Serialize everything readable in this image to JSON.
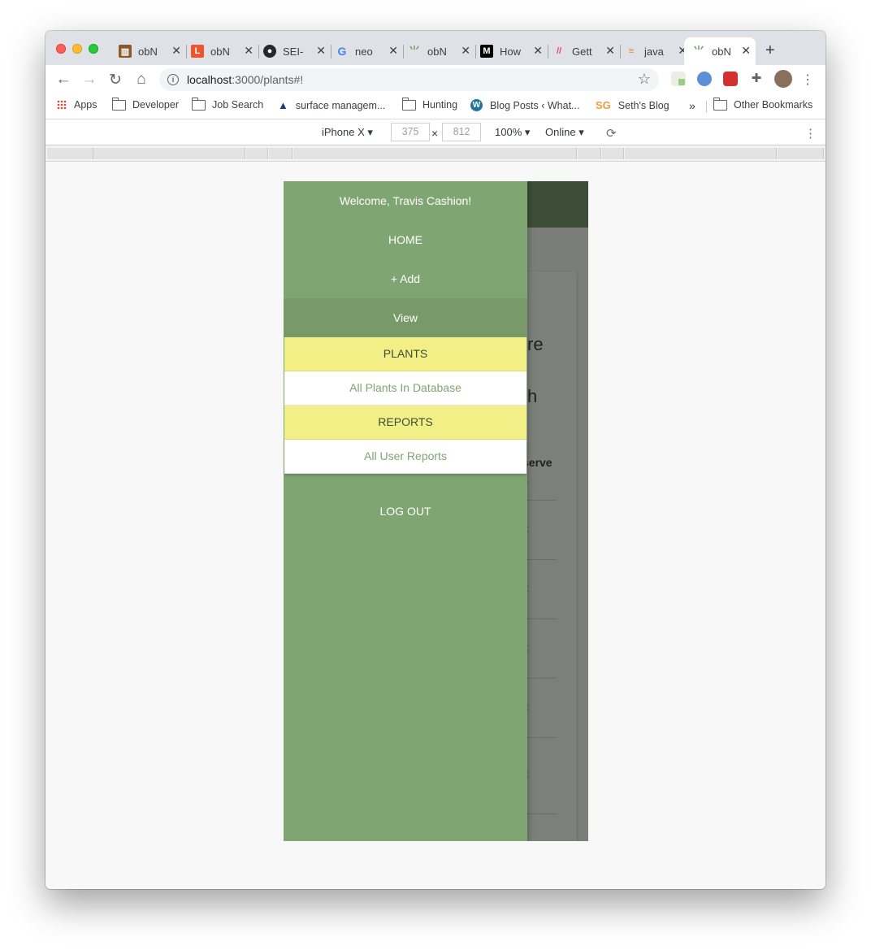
{
  "tabs": [
    {
      "label": "obN",
      "icon": "tab-favicon-icon",
      "color": "#8a5a2b"
    },
    {
      "label": "obN",
      "icon": "tab-favicon-icon",
      "color": "#f0532d"
    },
    {
      "label": "SEI-",
      "icon": "github-icon",
      "color": "#24292e"
    },
    {
      "label": "neo",
      "icon": "google-icon",
      "color": "#4285f4"
    },
    {
      "label": "obN",
      "icon": "sprout-icon",
      "color": "#7fa572"
    },
    {
      "label": "How",
      "icon": "medium-icon",
      "color": "#000000"
    },
    {
      "label": "Gett",
      "icon": "tab-favicon-icon",
      "color": "#ef4a5f"
    },
    {
      "label": "java",
      "icon": "stackoverflow-icon",
      "color": "#f48024"
    },
    {
      "label": "obN",
      "icon": "sprout-icon",
      "color": "#7fa572",
      "active": true
    }
  ],
  "address": {
    "host": "localhost",
    "path": ":3000/plants#!"
  },
  "bookmarks": {
    "apps": "Apps",
    "developer": "Developer",
    "job_search": "Job Search",
    "surface": "surface managem...",
    "hunting": "Hunting",
    "blog_posts": "Blog Posts ‹ What...",
    "seths_blog": "Seth's Blog",
    "seths_blog_icon_text": "SG",
    "more": "»",
    "other": "Other Bookmarks"
  },
  "device": {
    "model": "iPhone X",
    "width": "375",
    "height": "812",
    "zoom": "100%",
    "network": "Online"
  },
  "drawer": {
    "welcome": "Welcome, Travis Cashion!",
    "home": "HOME",
    "add": "+ Add",
    "view": "View",
    "plants_header": "PLANTS",
    "all_plants": "All Plants In Database",
    "reports_header": "REPORTS",
    "all_reports": "All User Reports",
    "logout": "LOG OUT"
  },
  "background_peek": {
    "line1": "re",
    "line2": "h",
    "column": "serve",
    "column2": "t"
  },
  "colors": {
    "drawer": "#7fa572",
    "drawer_selected": "#789a6b",
    "submenu_header": "#f2ef87",
    "appbar": "#3c4e37"
  }
}
